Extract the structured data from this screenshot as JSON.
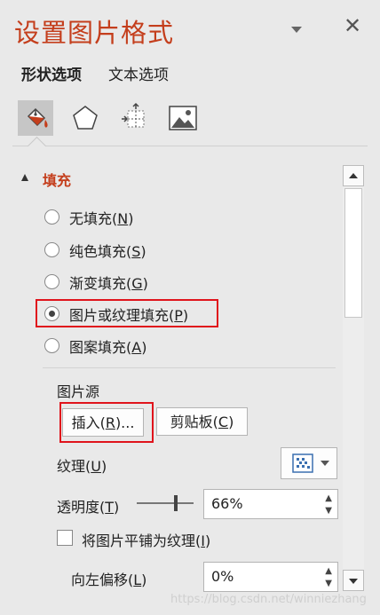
{
  "pane": {
    "title": "设置图片格式",
    "close_glyph": "✕"
  },
  "tabs": {
    "shape_options": "形状选项",
    "text_options": "文本选项"
  },
  "icon_tabs": [
    {
      "name": "fill-line-icon",
      "active": true
    },
    {
      "name": "effects-icon",
      "active": false
    },
    {
      "name": "size-properties-icon",
      "active": false
    },
    {
      "name": "picture-icon",
      "active": false
    }
  ],
  "fill_section": {
    "label": "填充",
    "options": [
      {
        "text": "无填充(",
        "key": "N",
        "end": ")",
        "checked": false
      },
      {
        "text": "纯色填充(",
        "key": "S",
        "end": ")",
        "checked": false
      },
      {
        "text": "渐变填充(",
        "key": "G",
        "end": ")",
        "checked": false
      },
      {
        "text": "图片或纹理填充(",
        "key": "P",
        "end": ")",
        "checked": true
      },
      {
        "text": "图案填充(",
        "key": "A",
        "end": ")",
        "checked": false
      }
    ],
    "picture_source_label": "图片源",
    "insert_button": {
      "text": "插入(",
      "key": "R",
      "end": ")..."
    },
    "clipboard_button": {
      "text": "剪贴板(",
      "key": "C",
      "end": ")"
    },
    "texture_label": {
      "text": "纹理(",
      "key": "U",
      "end": ")"
    },
    "transparency_label": {
      "text": "透明度(",
      "key": "T",
      "end": ")"
    },
    "transparency_value": "66%",
    "transparency_fraction": 0.66,
    "tile_label": {
      "text": "将图片平铺为纹理(",
      "key": "I",
      "end": ")"
    },
    "offset_left_label": {
      "text": "向左偏移(",
      "key": "L",
      "end": ")"
    },
    "offset_left_value": "0%"
  },
  "watermark": "https://blog.csdn.net/winniezhang",
  "colors": {
    "accent": "#c43e1c",
    "highlight": "#e0141c",
    "panel_bg": "#e9e9e9"
  }
}
